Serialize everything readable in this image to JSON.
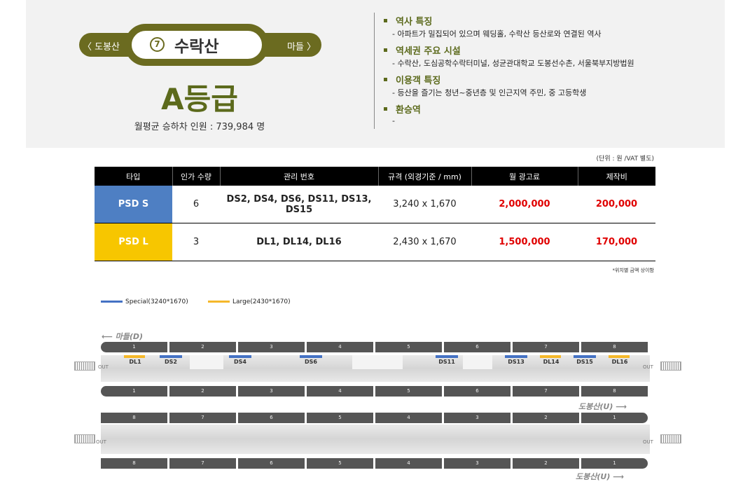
{
  "station": {
    "prev": "〈 도봉산",
    "next": "마들 〉",
    "number": "7",
    "name": "수락산",
    "grade": "A등급",
    "monthly": "월평균 승하차 인원 : 739,984 명"
  },
  "info": [
    {
      "title": "역사 특징",
      "desc": "-   아파트가 밀집되어 있으며 웨딩홀, 수락산 등산로와 연결된 역사"
    },
    {
      "title": "역세권 주요 시설",
      "desc": "-   수락산, 도심공학수락터미널, 성균관대학교 도봉선수촌, 서울북부지방법원"
    },
    {
      "title": "이용객 특징",
      "desc": "-   등산을 즐기는 청년~중년층 및 인근지역 주민, 중 고등학생"
    },
    {
      "title": "환승역",
      "desc": "-"
    }
  ],
  "table": {
    "unit": "(단위 : 원 /VAT 별도)",
    "headers": [
      "타입",
      "인가 수량",
      "관리 번호",
      "규격 (외경기준 / mm)",
      "월 광고료",
      "제작비"
    ],
    "rows": [
      {
        "type": "PSD S",
        "qty": "6",
        "codes": "DS2, DS4, DS6, DS11, DS13, DS15",
        "size": "3,240 x 1,670",
        "fee": "2,000,000",
        "cost": "200,000"
      },
      {
        "type": "PSD L",
        "qty": "3",
        "codes": "DL1, DL14, DL16",
        "size": "2,430 x 1,670",
        "fee": "1,500,000",
        "cost": "170,000"
      }
    ],
    "note": "*위치별 금액 상이함"
  },
  "legend": {
    "special": "Special(3240*1670)",
    "large": "Large(2430*1670)",
    "special_color": "#4472c4",
    "large_color": "#f5b82a"
  },
  "diagram": {
    "dir_madeul": "마들(D)",
    "dir_dobong": "도봉산(U)",
    "out": "OUT",
    "cars_fwd": [
      "1",
      "2",
      "3",
      "4",
      "5",
      "6",
      "7",
      "8"
    ],
    "cars_rev": [
      "8",
      "7",
      "6",
      "5",
      "4",
      "3",
      "2",
      "1"
    ],
    "screens": [
      "DL1",
      "DS2",
      "DS4",
      "DS6",
      "DS11",
      "DS13",
      "DL14",
      "DS15",
      "DL16"
    ]
  }
}
